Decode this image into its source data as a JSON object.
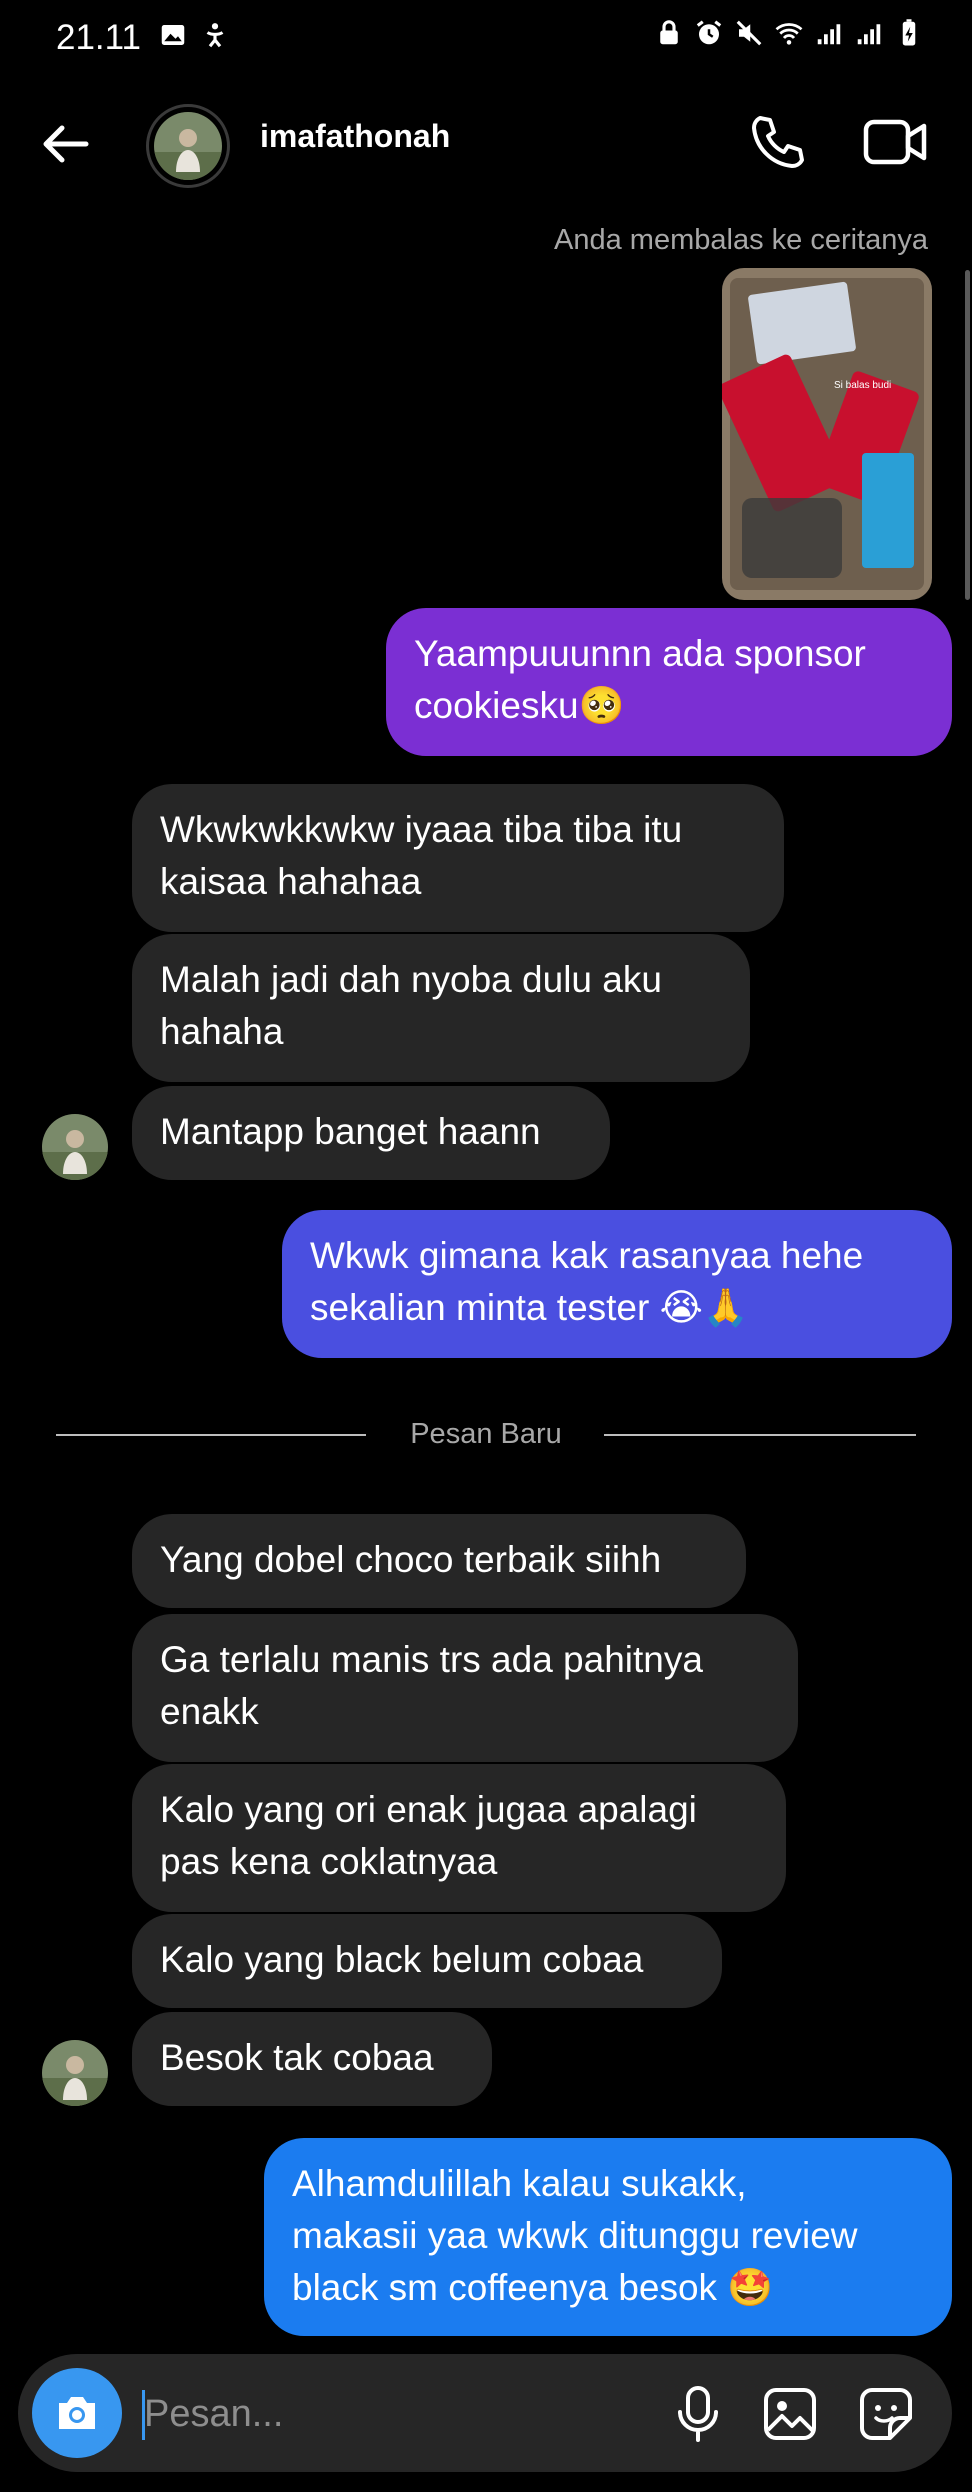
{
  "status_bar": {
    "time": "21.11",
    "left_icons": [
      "gallery-icon",
      "accessibility-icon"
    ],
    "right_icons": [
      "lock-icon",
      "alarm-icon",
      "mute-icon",
      "wifi-icon",
      "signal-icon",
      "signal-icon",
      "battery-charging-icon"
    ]
  },
  "header": {
    "username": "imafathonah",
    "back_icon": "arrow-left-icon",
    "call_icon": "phone-icon",
    "video_icon": "video-camera-icon"
  },
  "story_reply": {
    "label": "Anda membalas ke ceritanya",
    "sticker_text": "Si balas budi"
  },
  "messages_before_divider": [
    {
      "from": "me",
      "lines": [
        "Yaampuuunnn ada sponsor",
        "cookiesku🥺"
      ],
      "color": "#7b2fd3"
    },
    {
      "from": "them",
      "lines": [
        "Wkwkwkkwkw iyaaa tiba tiba itu",
        "kaisaa hahahaa"
      ]
    },
    {
      "from": "them",
      "lines": [
        "Malah jadi dah nyoba dulu aku",
        "hahaha"
      ]
    },
    {
      "from": "them",
      "lines": [
        "Mantapp banget haann"
      ]
    },
    {
      "from": "me",
      "lines": [
        "Wkwk gimana kak rasanyaa hehe",
        "sekalian minta tester 😭🙏"
      ],
      "color": "#4a4fe0"
    }
  ],
  "divider": {
    "label": "Pesan Baru"
  },
  "messages_after_divider": [
    {
      "from": "them",
      "lines": [
        "Yang dobel choco terbaik siihh"
      ]
    },
    {
      "from": "them",
      "lines": [
        "Ga terlalu manis trs ada pahitnya",
        "enakk"
      ]
    },
    {
      "from": "them",
      "lines": [
        "Kalo yang ori enak jugaa apalagi",
        "pas kena coklatnyaa"
      ]
    },
    {
      "from": "them",
      "lines": [
        "Kalo yang black belum cobaa"
      ]
    },
    {
      "from": "them",
      "lines": [
        "Besok tak cobaa"
      ]
    },
    {
      "from": "me",
      "lines": [
        "Alhamdulillah kalau sukakk,",
        "makasii yaa wkwk ditunggu review",
        "black sm coffeenya besok 🤩"
      ],
      "color": "#1b7cf0"
    }
  ],
  "composer": {
    "placeholder": "Pesan...",
    "camera_icon": "camera-icon",
    "mic_icon": "microphone-icon",
    "gallery_icon": "image-icon",
    "sticker_icon": "sticker-icon"
  },
  "colors": {
    "background": "#000000",
    "incoming_bubble": "#262626",
    "accent": "#3897f0"
  }
}
